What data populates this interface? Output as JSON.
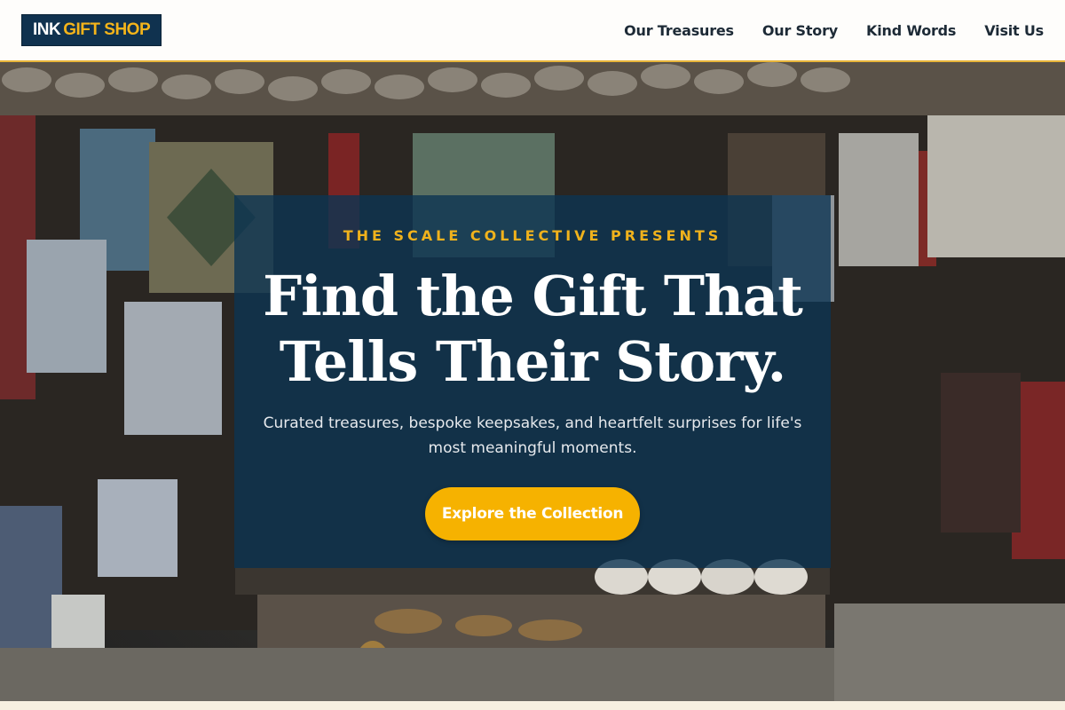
{
  "header": {
    "logo": {
      "ink": "INK",
      "gift": "GIFT SHOP"
    },
    "nav": [
      "Our Treasures",
      "Our Story",
      "Kind Words",
      "Visit Us"
    ]
  },
  "hero": {
    "background_image": "gift-shop-storefront-photo",
    "eyebrow": "THE SCALE COLLECTIVE PRESENTS",
    "headline_line1": "Find the Gift That",
    "headline_line2": "Tells Their Story.",
    "subtext": "Curated treasures, bespoke keepsakes, and heartfelt surprises for life's most meaningful moments.",
    "cta_label": "Explore the Collection"
  },
  "colors": {
    "accent": "#f6b200",
    "brand_navy": "#10324f",
    "overlay": "rgba(12,52,82,0.80)"
  }
}
